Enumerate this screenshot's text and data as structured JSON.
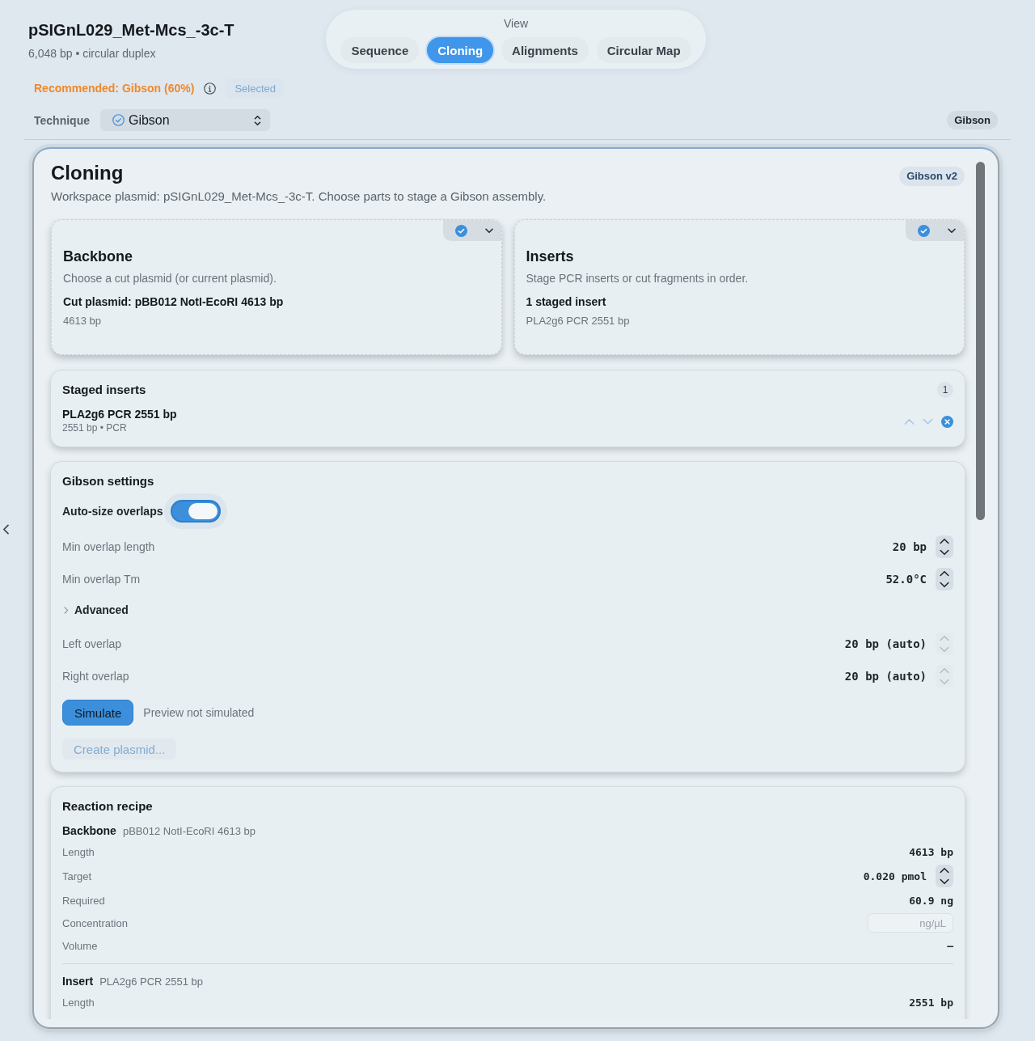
{
  "document": {
    "title": "pSIGnL029_Met-Mcs_-3c-T",
    "subtitle": "6,048 bp • circular duplex"
  },
  "view_switch": {
    "label": "View",
    "tabs": [
      {
        "label": "Sequence",
        "selected": false
      },
      {
        "label": "Cloning",
        "selected": true
      },
      {
        "label": "Alignments",
        "selected": false
      },
      {
        "label": "Circular Map",
        "selected": false
      }
    ]
  },
  "recommendation": {
    "text": "Recommended: Gibson (60%)",
    "button": {
      "label": "Selected",
      "disabled": true
    }
  },
  "technique": {
    "label": "Technique",
    "value": "Gibson",
    "badge": "Gibson"
  },
  "panel": {
    "title": "Cloning",
    "description": "Workspace plasmid: pSIGnL029_Met-Mcs_-3c-T. Choose parts to stage a Gibson assembly.",
    "badge": "Gibson v2"
  },
  "part_cards": [
    {
      "title": "Backbone",
      "description": "Choose a cut plasmid (or current plasmid).",
      "selection": "Cut plasmid: pBB012 NotI-EcoRI 4613 bp",
      "detail": "4613 bp"
    },
    {
      "title": "Inserts",
      "description": "Stage PCR inserts or cut fragments in order.",
      "selection": "1 staged insert",
      "detail": "PLA2g6 PCR 2551 bp"
    }
  ],
  "staged_inserts": {
    "title": "Staged inserts",
    "count": "1",
    "items": [
      {
        "name": "PLA2g6 PCR 2551 bp",
        "detail": "2551 bp • PCR"
      }
    ]
  },
  "gibson_settings": {
    "title": "Gibson settings",
    "auto_size": {
      "label": "Auto-size overlaps",
      "on": true
    },
    "rows": [
      {
        "kind": "stepper",
        "label": "Min overlap length",
        "value": "20 bp",
        "disabled": false
      },
      {
        "kind": "stepper",
        "label": "Min overlap Tm",
        "value": "52.0°C",
        "disabled": false
      },
      {
        "kind": "disclosure",
        "label": "Advanced",
        "expanded": false
      },
      {
        "kind": "stepper",
        "label": "Left overlap",
        "value": "20 bp (auto)",
        "disabled": true
      },
      {
        "kind": "stepper",
        "label": "Right overlap",
        "value": "20 bp (auto)",
        "disabled": true
      }
    ],
    "simulate": {
      "label": "Simulate",
      "status": "Preview not simulated"
    },
    "create": {
      "label": "Create plasmid...",
      "disabled": true
    }
  },
  "reaction_recipe": {
    "title": "Reaction recipe",
    "parts": [
      {
        "role": "Backbone",
        "name": "pBB012 NotI-EcoRI 4613 bp",
        "rows": [
          {
            "kind": "value",
            "label": "Length",
            "value": "4613 bp"
          },
          {
            "kind": "stepper",
            "label": "Target",
            "value": "0.020 pmol"
          },
          {
            "kind": "value",
            "label": "Required",
            "value": "60.9 ng"
          },
          {
            "kind": "input",
            "label": "Concentration",
            "placeholder": "ng/µL"
          },
          {
            "kind": "value",
            "label": "Volume",
            "value": "–"
          }
        ]
      },
      {
        "role": "Insert",
        "name": "PLA2g6 PCR 2551 bp",
        "rows": [
          {
            "kind": "value",
            "label": "Length",
            "value": "2551 bp"
          }
        ]
      }
    ]
  }
}
